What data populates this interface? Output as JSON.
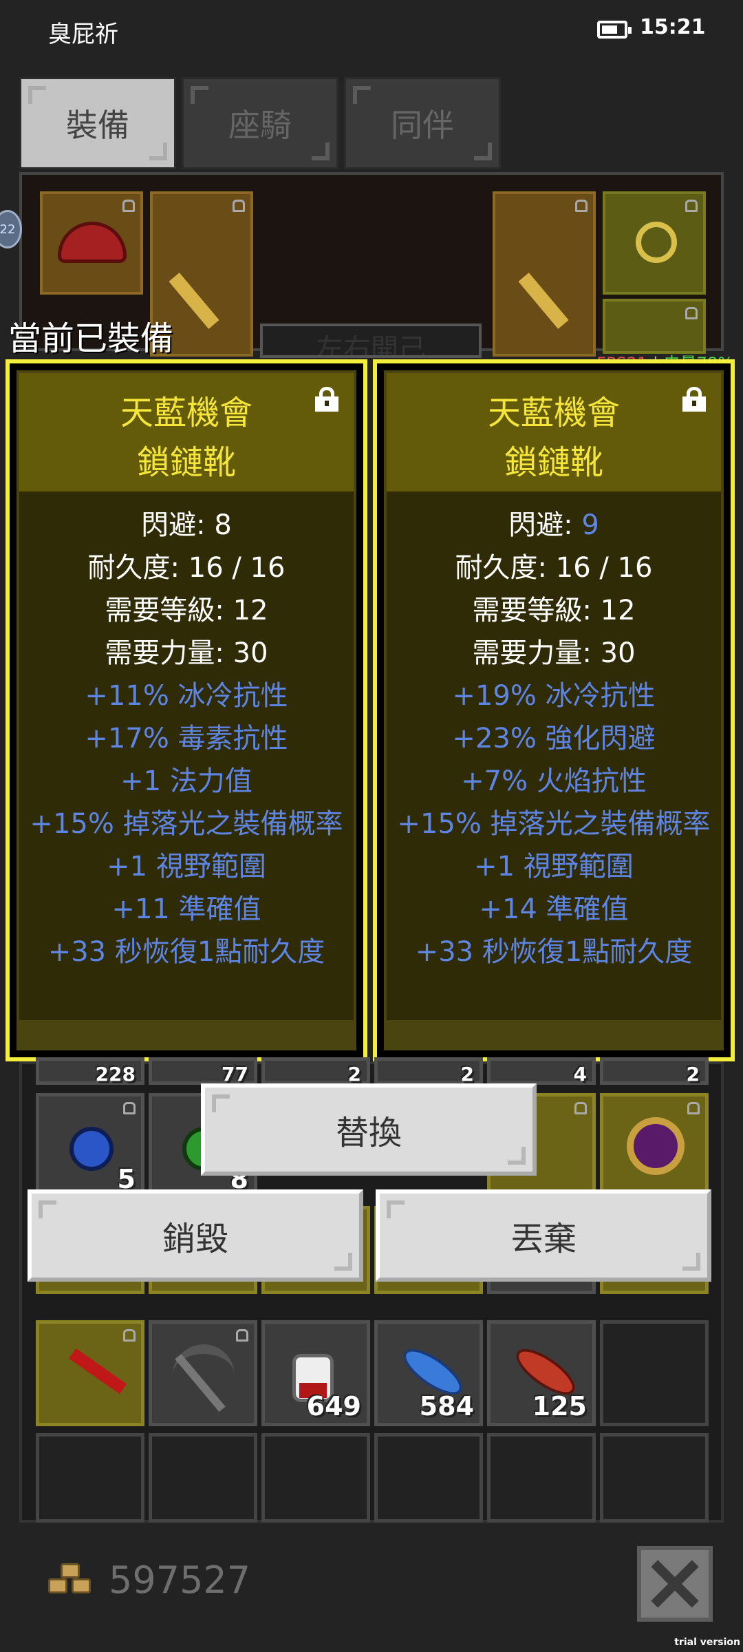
{
  "status_bar": {
    "carrier": "臭屁祈",
    "time": "15:21"
  },
  "tabs": [
    {
      "label": "裝備",
      "active": true
    },
    {
      "label": "座騎",
      "active": false
    },
    {
      "label": "同伴",
      "active": false
    }
  ],
  "equipment_panel": {
    "level_badge": "22",
    "shop_sign": "左右開己"
  },
  "current_equipped_label": "當前已裝備",
  "fps": {
    "fps": "FPS21",
    "sep": "|",
    "battery": "电量78%"
  },
  "cards": [
    {
      "name_line1": "天藍機會",
      "name_line2": "鎖鏈靴",
      "stats": [
        {
          "label": "閃避: ",
          "value": "8",
          "style": "white"
        },
        {
          "label": "耐久度: ",
          "value": "16 / 16",
          "style": "white"
        },
        {
          "label": "需要等級: ",
          "value": "12",
          "style": "white"
        },
        {
          "label": "需要力量: ",
          "value": "30",
          "style": "white"
        },
        {
          "text": "+11% 冰冷抗性",
          "style": "blue"
        },
        {
          "text": "+17% 毒素抗性",
          "style": "blue"
        },
        {
          "text": "+1 法力值",
          "style": "blue"
        },
        {
          "text": "+15% 掉落光之裝備概率",
          "style": "blue"
        },
        {
          "text": "+1 視野範圍",
          "style": "blue"
        },
        {
          "text": "+11 準確值",
          "style": "blue"
        },
        {
          "text": "+33 秒恢復1點耐久度",
          "style": "blue"
        }
      ]
    },
    {
      "name_line1": "天藍機會",
      "name_line2": "鎖鏈靴",
      "stats": [
        {
          "label": "閃避: ",
          "value": "9",
          "style": "white-bluevalue"
        },
        {
          "label": "耐久度: ",
          "value": "16 / 16",
          "style": "white"
        },
        {
          "label": "需要等級: ",
          "value": "12",
          "style": "white"
        },
        {
          "label": "需要力量: ",
          "value": "30",
          "style": "white"
        },
        {
          "text": "+19% 冰冷抗性",
          "style": "blue"
        },
        {
          "text": "+23% 強化閃避",
          "style": "blue"
        },
        {
          "text": "+7% 火焰抗性",
          "style": "blue"
        },
        {
          "text": "+15% 掉落光之裝備概率",
          "style": "blue"
        },
        {
          "text": "+1 視野範圍",
          "style": "blue"
        },
        {
          "text": "+14 準確值",
          "style": "blue"
        },
        {
          "text": "+33 秒恢復1點耐久度",
          "style": "blue"
        }
      ]
    }
  ],
  "inventory": {
    "partial_row_counts": [
      "228",
      "77",
      "2",
      "2",
      "4",
      "2"
    ],
    "row2": [
      {
        "icon": "blue-gem-icon",
        "count": "5"
      },
      {
        "icon": "green-gem-icon",
        "count": "8"
      }
    ],
    "row3": [
      {
        "icon": "red-scarf-icon",
        "count": ""
      },
      {
        "icon": "pickaxe-icon",
        "count": ""
      },
      {
        "icon": "health-potion-icon",
        "count": "649"
      },
      {
        "icon": "blue-feather-icon",
        "count": "584"
      },
      {
        "icon": "red-feather-icon",
        "count": "125"
      },
      {
        "icon": "empty-slot",
        "count": ""
      }
    ]
  },
  "buttons": {
    "replace": "替換",
    "destroy": "銷毀",
    "discard": "丟棄"
  },
  "footer": {
    "gold": "597527",
    "trial": "trial version"
  }
}
